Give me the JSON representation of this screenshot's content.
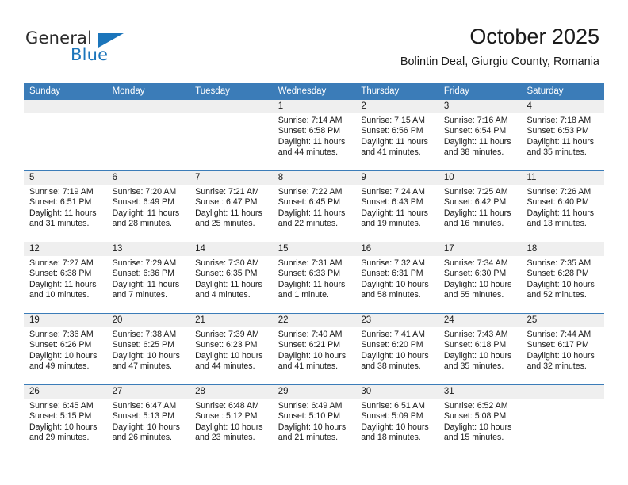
{
  "brand": {
    "name_part1": "General",
    "name_part2": "Blue",
    "accent_color": "#1b75bb"
  },
  "header": {
    "title": "October 2025",
    "subtitle": "Bolintin Deal, Giurgiu County, Romania"
  },
  "calendar": {
    "header_bg": "#3b7cb8",
    "daynum_bg": "#efefef",
    "weekday_headers": [
      "Sunday",
      "Monday",
      "Tuesday",
      "Wednesday",
      "Thursday",
      "Friday",
      "Saturday"
    ],
    "weeks": [
      [
        {
          "day": "",
          "sunrise": "",
          "sunset": "",
          "daylight": "",
          "empty": true
        },
        {
          "day": "",
          "sunrise": "",
          "sunset": "",
          "daylight": "",
          "empty": true
        },
        {
          "day": "",
          "sunrise": "",
          "sunset": "",
          "daylight": "",
          "empty": true
        },
        {
          "day": "1",
          "sunrise": "Sunrise: 7:14 AM",
          "sunset": "Sunset: 6:58 PM",
          "daylight": "Daylight: 11 hours and 44 minutes."
        },
        {
          "day": "2",
          "sunrise": "Sunrise: 7:15 AM",
          "sunset": "Sunset: 6:56 PM",
          "daylight": "Daylight: 11 hours and 41 minutes."
        },
        {
          "day": "3",
          "sunrise": "Sunrise: 7:16 AM",
          "sunset": "Sunset: 6:54 PM",
          "daylight": "Daylight: 11 hours and 38 minutes."
        },
        {
          "day": "4",
          "sunrise": "Sunrise: 7:18 AM",
          "sunset": "Sunset: 6:53 PM",
          "daylight": "Daylight: 11 hours and 35 minutes."
        }
      ],
      [
        {
          "day": "5",
          "sunrise": "Sunrise: 7:19 AM",
          "sunset": "Sunset: 6:51 PM",
          "daylight": "Daylight: 11 hours and 31 minutes."
        },
        {
          "day": "6",
          "sunrise": "Sunrise: 7:20 AM",
          "sunset": "Sunset: 6:49 PM",
          "daylight": "Daylight: 11 hours and 28 minutes."
        },
        {
          "day": "7",
          "sunrise": "Sunrise: 7:21 AM",
          "sunset": "Sunset: 6:47 PM",
          "daylight": "Daylight: 11 hours and 25 minutes."
        },
        {
          "day": "8",
          "sunrise": "Sunrise: 7:22 AM",
          "sunset": "Sunset: 6:45 PM",
          "daylight": "Daylight: 11 hours and 22 minutes."
        },
        {
          "day": "9",
          "sunrise": "Sunrise: 7:24 AM",
          "sunset": "Sunset: 6:43 PM",
          "daylight": "Daylight: 11 hours and 19 minutes."
        },
        {
          "day": "10",
          "sunrise": "Sunrise: 7:25 AM",
          "sunset": "Sunset: 6:42 PM",
          "daylight": "Daylight: 11 hours and 16 minutes."
        },
        {
          "day": "11",
          "sunrise": "Sunrise: 7:26 AM",
          "sunset": "Sunset: 6:40 PM",
          "daylight": "Daylight: 11 hours and 13 minutes."
        }
      ],
      [
        {
          "day": "12",
          "sunrise": "Sunrise: 7:27 AM",
          "sunset": "Sunset: 6:38 PM",
          "daylight": "Daylight: 11 hours and 10 minutes."
        },
        {
          "day": "13",
          "sunrise": "Sunrise: 7:29 AM",
          "sunset": "Sunset: 6:36 PM",
          "daylight": "Daylight: 11 hours and 7 minutes."
        },
        {
          "day": "14",
          "sunrise": "Sunrise: 7:30 AM",
          "sunset": "Sunset: 6:35 PM",
          "daylight": "Daylight: 11 hours and 4 minutes."
        },
        {
          "day": "15",
          "sunrise": "Sunrise: 7:31 AM",
          "sunset": "Sunset: 6:33 PM",
          "daylight": "Daylight: 11 hours and 1 minute."
        },
        {
          "day": "16",
          "sunrise": "Sunrise: 7:32 AM",
          "sunset": "Sunset: 6:31 PM",
          "daylight": "Daylight: 10 hours and 58 minutes."
        },
        {
          "day": "17",
          "sunrise": "Sunrise: 7:34 AM",
          "sunset": "Sunset: 6:30 PM",
          "daylight": "Daylight: 10 hours and 55 minutes."
        },
        {
          "day": "18",
          "sunrise": "Sunrise: 7:35 AM",
          "sunset": "Sunset: 6:28 PM",
          "daylight": "Daylight: 10 hours and 52 minutes."
        }
      ],
      [
        {
          "day": "19",
          "sunrise": "Sunrise: 7:36 AM",
          "sunset": "Sunset: 6:26 PM",
          "daylight": "Daylight: 10 hours and 49 minutes."
        },
        {
          "day": "20",
          "sunrise": "Sunrise: 7:38 AM",
          "sunset": "Sunset: 6:25 PM",
          "daylight": "Daylight: 10 hours and 47 minutes."
        },
        {
          "day": "21",
          "sunrise": "Sunrise: 7:39 AM",
          "sunset": "Sunset: 6:23 PM",
          "daylight": "Daylight: 10 hours and 44 minutes."
        },
        {
          "day": "22",
          "sunrise": "Sunrise: 7:40 AM",
          "sunset": "Sunset: 6:21 PM",
          "daylight": "Daylight: 10 hours and 41 minutes."
        },
        {
          "day": "23",
          "sunrise": "Sunrise: 7:41 AM",
          "sunset": "Sunset: 6:20 PM",
          "daylight": "Daylight: 10 hours and 38 minutes."
        },
        {
          "day": "24",
          "sunrise": "Sunrise: 7:43 AM",
          "sunset": "Sunset: 6:18 PM",
          "daylight": "Daylight: 10 hours and 35 minutes."
        },
        {
          "day": "25",
          "sunrise": "Sunrise: 7:44 AM",
          "sunset": "Sunset: 6:17 PM",
          "daylight": "Daylight: 10 hours and 32 minutes."
        }
      ],
      [
        {
          "day": "26",
          "sunrise": "Sunrise: 6:45 AM",
          "sunset": "Sunset: 5:15 PM",
          "daylight": "Daylight: 10 hours and 29 minutes."
        },
        {
          "day": "27",
          "sunrise": "Sunrise: 6:47 AM",
          "sunset": "Sunset: 5:13 PM",
          "daylight": "Daylight: 10 hours and 26 minutes."
        },
        {
          "day": "28",
          "sunrise": "Sunrise: 6:48 AM",
          "sunset": "Sunset: 5:12 PM",
          "daylight": "Daylight: 10 hours and 23 minutes."
        },
        {
          "day": "29",
          "sunrise": "Sunrise: 6:49 AM",
          "sunset": "Sunset: 5:10 PM",
          "daylight": "Daylight: 10 hours and 21 minutes."
        },
        {
          "day": "30",
          "sunrise": "Sunrise: 6:51 AM",
          "sunset": "Sunset: 5:09 PM",
          "daylight": "Daylight: 10 hours and 18 minutes."
        },
        {
          "day": "31",
          "sunrise": "Sunrise: 6:52 AM",
          "sunset": "Sunset: 5:08 PM",
          "daylight": "Daylight: 10 hours and 15 minutes."
        },
        {
          "day": "",
          "sunrise": "",
          "sunset": "",
          "daylight": "",
          "empty": true
        }
      ]
    ]
  }
}
